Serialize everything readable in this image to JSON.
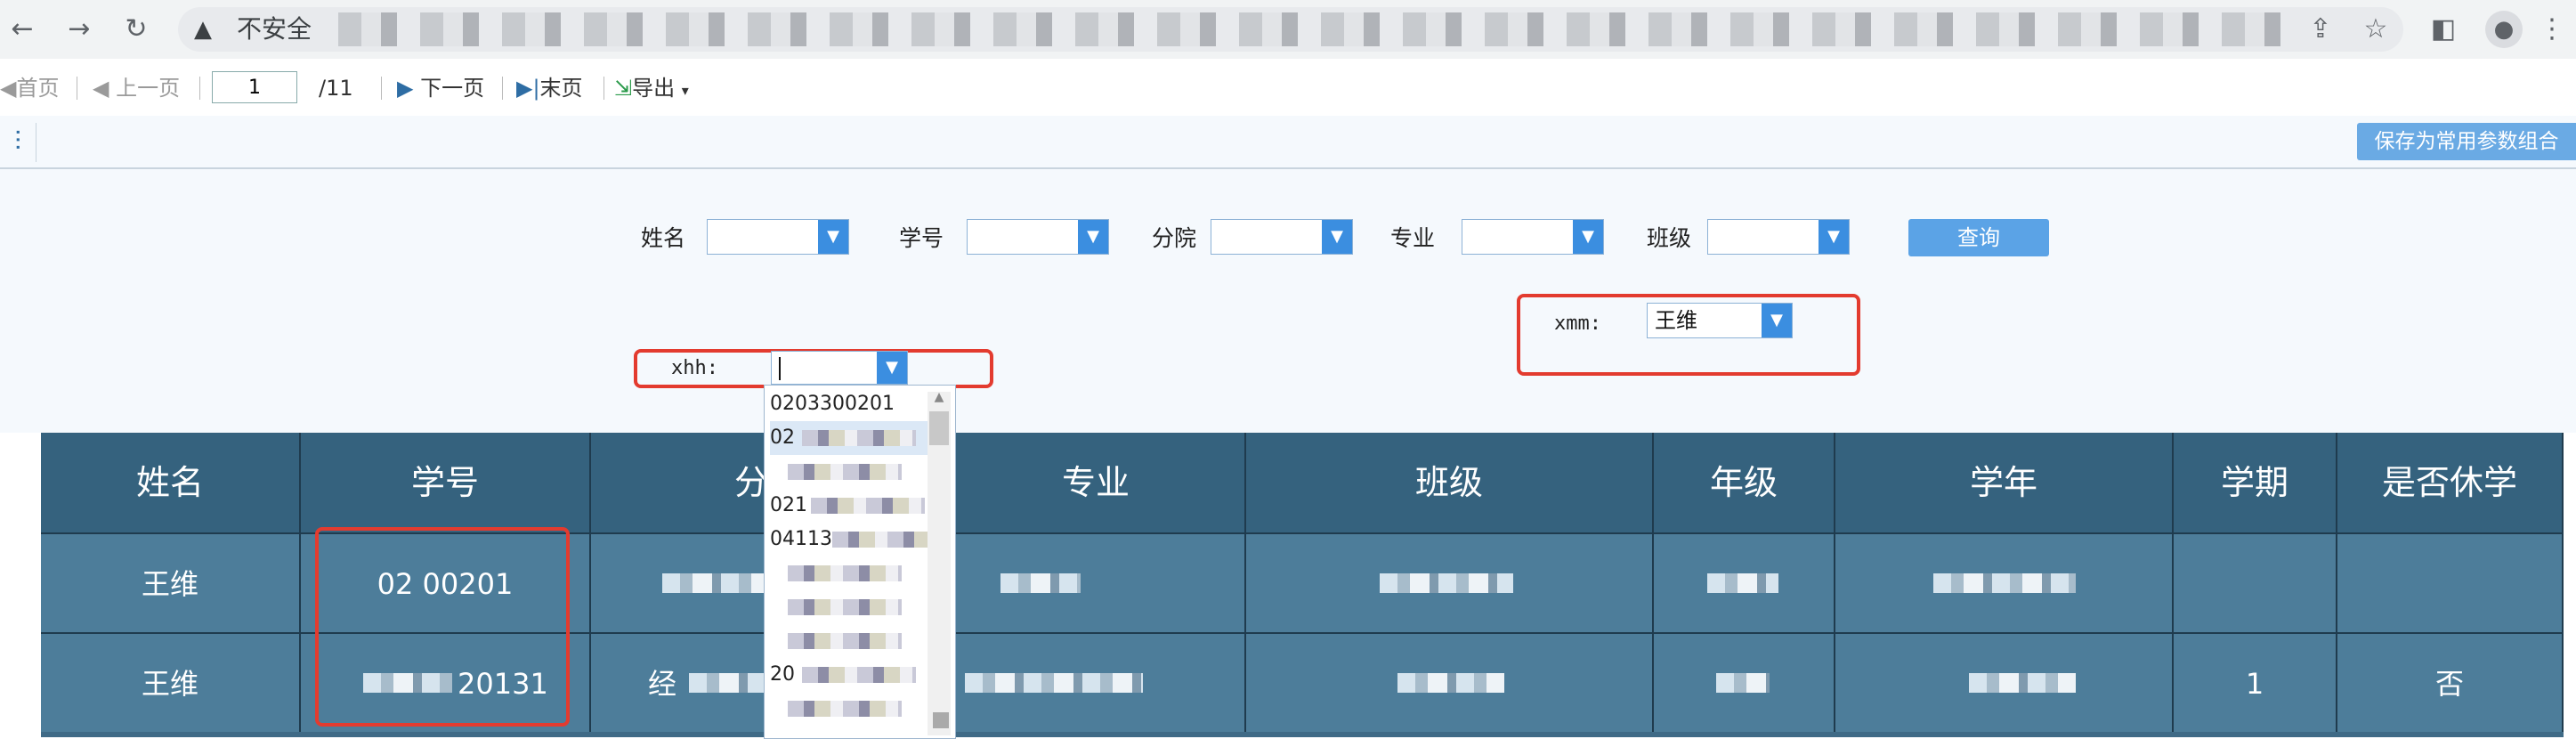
{
  "browser": {
    "security_label": "不安全",
    "security_icon": "warning-triangle-icon",
    "nav_icons": [
      "back-arrow-icon",
      "forward-arrow-icon",
      "reload-icon"
    ],
    "toolbar_icons": [
      "share-icon",
      "star-icon",
      "side-panel-icon",
      "profile-icon",
      "more-icon"
    ]
  },
  "report_toolbar": {
    "first_page": "首页",
    "prev_page": "上一页",
    "page_value": "1",
    "page_total": "/11",
    "next_page": "下一页",
    "last_page": "末页",
    "export": "导出"
  },
  "param_panel": {
    "save_combo_button": "保存为常用参数组合",
    "fields": [
      {
        "label": "姓名",
        "value": ""
      },
      {
        "label": "学号",
        "value": ""
      },
      {
        "label": "分院",
        "value": ""
      },
      {
        "label": "专业",
        "value": ""
      },
      {
        "label": "班级",
        "value": ""
      }
    ],
    "query_button": "查询",
    "xhh": {
      "label": "xhh:",
      "value": ""
    },
    "xmm": {
      "label": "xmm:",
      "value": "王维"
    }
  },
  "xhh_dropdown": {
    "items": [
      "0203300201",
      "02",
      "",
      "021",
      "04113",
      "",
      "",
      "",
      "20",
      ""
    ]
  },
  "table": {
    "headers": [
      "姓名",
      "学号",
      "分院",
      "专业",
      "班级",
      "年级",
      "学年",
      "学期",
      "是否休学"
    ],
    "rows": [
      {
        "name": "王维",
        "student_id": "02 00201",
        "college": "",
        "major": "",
        "class": "",
        "grade": "",
        "year": "",
        "term": "",
        "suspended": ""
      },
      {
        "name": "王维",
        "student_id": "20131",
        "college": "经",
        "major": "",
        "class": "",
        "grade": "",
        "year": "",
        "term": "1",
        "suspended": "否"
      }
    ]
  }
}
